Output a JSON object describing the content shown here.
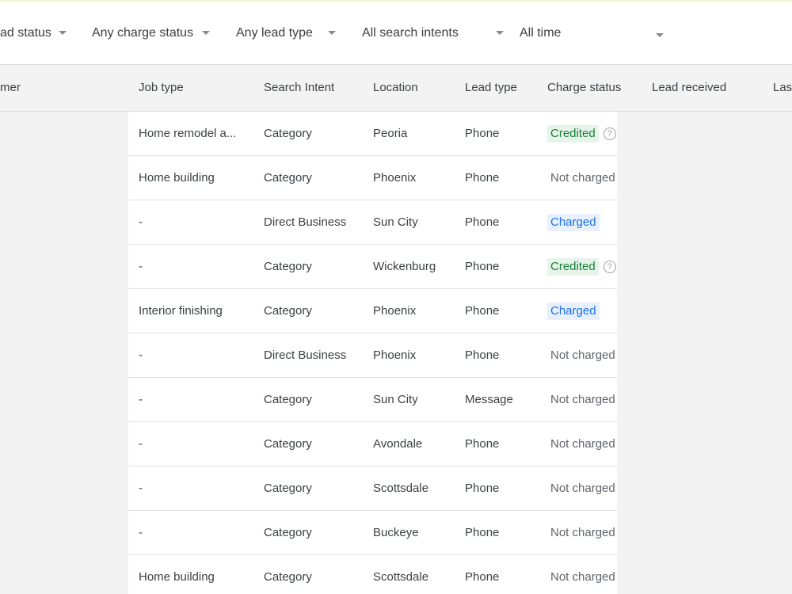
{
  "filters": [
    {
      "label": "ad status",
      "icon": "chevron-down-icon"
    },
    {
      "label": "Any charge status",
      "icon": "chevron-down-icon"
    },
    {
      "label": "Any lead type",
      "icon": "chevron-down-icon"
    },
    {
      "label": "All search intents",
      "icon": "chevron-down-icon"
    },
    {
      "label": "All time",
      "icon": "chevron-down-icon"
    }
  ],
  "columns": [
    "mer",
    "Job type",
    "Search Intent",
    "Location",
    "Lead type",
    "Charge status",
    "Lead received",
    "Las"
  ],
  "rows": [
    {
      "job": "Home remodel a...",
      "intent": "Category",
      "location": "Peoria",
      "lead_type": "Phone",
      "charge": "Credited",
      "charge_kind": "credited",
      "help": "?"
    },
    {
      "job": "Home building",
      "intent": "Category",
      "location": "Phoenix",
      "lead_type": "Phone",
      "charge": "Not charged",
      "charge_kind": "none",
      "help": ""
    },
    {
      "job": "-",
      "intent": "Direct Business",
      "location": "Sun City",
      "lead_type": "Phone",
      "charge": "Charged",
      "charge_kind": "charged",
      "help": ""
    },
    {
      "job": "-",
      "intent": "Category",
      "location": "Wickenburg",
      "lead_type": "Phone",
      "charge": "Credited",
      "charge_kind": "credited",
      "help": "?"
    },
    {
      "job": "Interior finishing",
      "intent": "Category",
      "location": "Phoenix",
      "lead_type": "Phone",
      "charge": "Charged",
      "charge_kind": "charged",
      "help": ""
    },
    {
      "job": "-",
      "intent": "Direct Business",
      "location": "Phoenix",
      "lead_type": "Phone",
      "charge": "Not charged",
      "charge_kind": "none",
      "help": ""
    },
    {
      "job": "-",
      "intent": "Category",
      "location": "Sun City",
      "lead_type": "Message",
      "charge": "Not charged",
      "charge_kind": "none",
      "help": ""
    },
    {
      "job": "-",
      "intent": "Category",
      "location": "Avondale",
      "lead_type": "Phone",
      "charge": "Not charged",
      "charge_kind": "none",
      "help": ""
    },
    {
      "job": "-",
      "intent": "Category",
      "location": "Scottsdale",
      "lead_type": "Phone",
      "charge": "Not charged",
      "charge_kind": "none",
      "help": ""
    },
    {
      "job": "-",
      "intent": "Category",
      "location": "Buckeye",
      "lead_type": "Phone",
      "charge": "Not charged",
      "charge_kind": "none",
      "help": ""
    },
    {
      "job": "Home building",
      "intent": "Category",
      "location": "Scottsdale",
      "lead_type": "Phone",
      "charge": "Not charged",
      "charge_kind": "none",
      "help": ""
    }
  ],
  "colors": {
    "credited": "#188038",
    "charged": "#1a73e8",
    "not_charged": "#5f6368"
  }
}
